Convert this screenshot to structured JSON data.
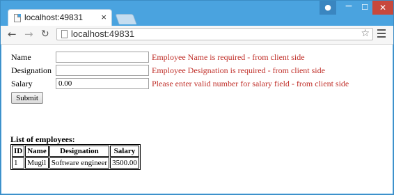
{
  "browser": {
    "tab_title": "localhost:49831",
    "tab_close": "×",
    "address": "localhost:49831",
    "controls": {
      "minimize": "−",
      "maximize": "☐",
      "close": "✕"
    }
  },
  "form": {
    "name": {
      "label": "Name",
      "value": "",
      "error": "Employee Name is required - from client side"
    },
    "designation": {
      "label": "Designation",
      "value": "",
      "error": "Employee Designation is required - from client side"
    },
    "salary": {
      "label": "Salary",
      "value": "0.00",
      "error": "Please enter valid number for salary field - from client side"
    },
    "submit_label": "Submit"
  },
  "employees": {
    "title": "List of employees:",
    "headers": [
      "ID",
      "Name",
      "Designation",
      "Salary"
    ],
    "rows": [
      [
        "1",
        "Mugil",
        "Software engineer",
        "3500.00"
      ]
    ]
  },
  "colors": {
    "error": "#c0302a",
    "window_frame": "#4aa3df",
    "close_button": "#c7483c"
  }
}
